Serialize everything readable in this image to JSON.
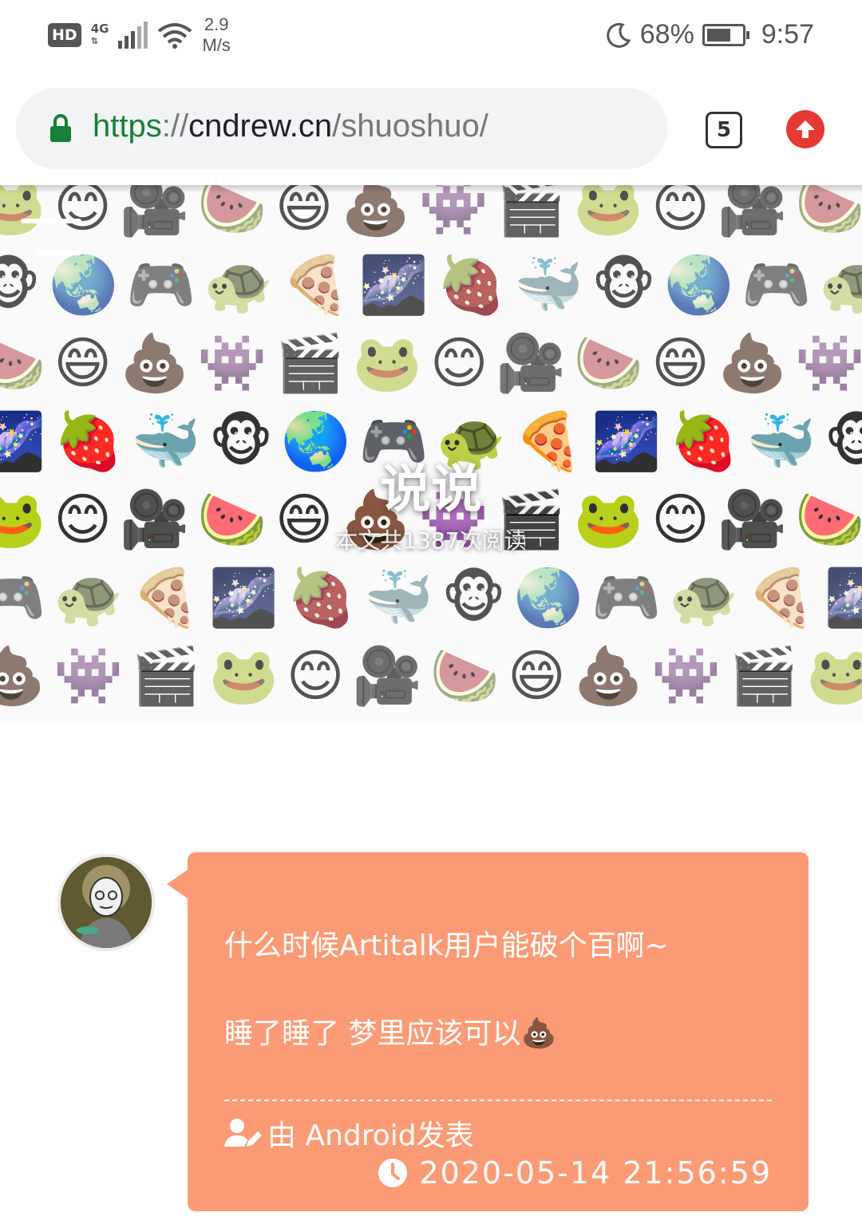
{
  "status_bar": {
    "hd": "HD",
    "network": "4G",
    "speed_value": "2.9",
    "speed_unit": "M/s",
    "battery_percent": "68%",
    "battery_level": 0.68,
    "time": "9:57"
  },
  "browser": {
    "url_scheme": "https",
    "url_sep": "://",
    "url_host": "cndrew.cn",
    "url_path": "/shuoshuo/",
    "tab_count": "5"
  },
  "hero": {
    "title": "说说",
    "subtitle": "本文共1387次阅读",
    "emoji_rows": [
      "🐸😊🎥🍉😄💩👾🎬🐸😊🎥🍉",
      "🐵🌏🎮🐢🍕🌌🍓🐳🐵🌏🎮🐢",
      "🍉😄💩👾🎬🐸😊🎥🍉😄💩👾",
      "🌌🍓🐳🐵🌏🎮🐢🍕🌌🍓🐳🐵",
      "🐸😊🎥🍉😄💩👾🎬🐸😊🎥🍉",
      "🎮🐢🍕🌌🍓🐳🐵🌏🎮🐢🍕🌌",
      "💩👾🎬🐸😊🎥🍉😄💩👾🎬🐸"
    ]
  },
  "post": {
    "line1": "什么时候Artitalk用户能破个百啊~",
    "line2": "睡了睡了 梦里应该可以💩",
    "device": "由 Android发表",
    "datetime": "2020-05-14 21:56:59",
    "accent_color": "#fb9b76"
  }
}
